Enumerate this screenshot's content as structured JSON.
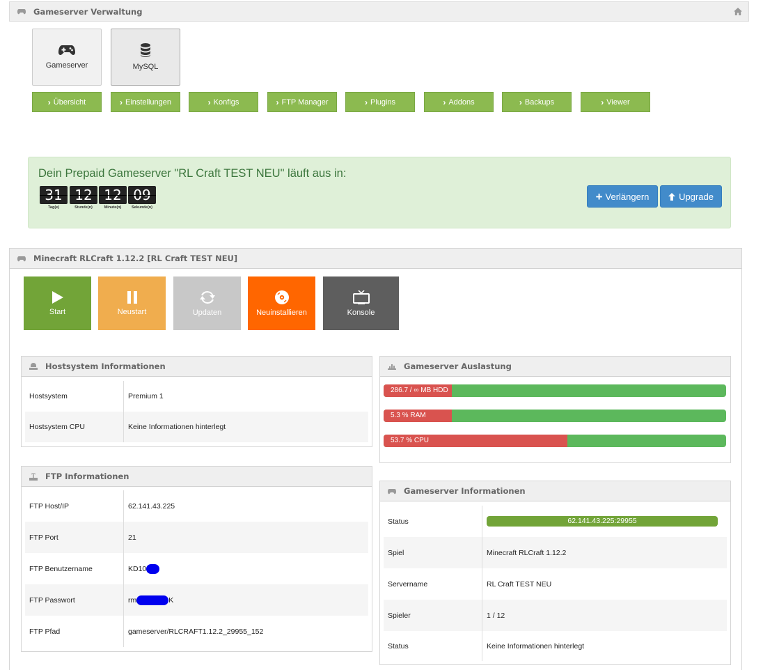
{
  "top": {
    "title": "Gameserver Verwaltung"
  },
  "tiles": [
    {
      "label": "Gameserver",
      "icon": "gamepad-icon"
    },
    {
      "label": "MySQL",
      "icon": "database-icon"
    }
  ],
  "nav": [
    "Übersicht",
    "Einstellungen",
    "Konfigs",
    "FTP Manager",
    "Plugins",
    "Addons",
    "Backups",
    "Viewer"
  ],
  "prepaid": {
    "text": "Dein Prepaid Gameserver \"RL Craft TEST NEU\" läuft aus in:",
    "countdown": [
      {
        "value": "31",
        "label": "Tag(e)"
      },
      {
        "value": "12",
        "label": "Stunde(n)"
      },
      {
        "value": "12",
        "label": "Minute(n)"
      },
      {
        "value": "09",
        "label": "Sekunde(n)"
      }
    ],
    "extend_label": "Verlängern",
    "upgrade_label": "Upgrade"
  },
  "server": {
    "title": "Minecraft RLCraft 1.12.2 [RL Craft TEST NEU]",
    "actions": [
      {
        "label": "Start",
        "color": "#72a438",
        "icon": "play-icon"
      },
      {
        "label": "Neustart",
        "color": "#f0ad4e",
        "icon": "pause-icon"
      },
      {
        "label": "Updaten",
        "color": "#c8c8c8",
        "icon": "refresh-icon"
      },
      {
        "label": "Neuinstallieren",
        "color": "#ff6600",
        "icon": "disc-icon"
      },
      {
        "label": "Konsole",
        "color": "#5e5e5e",
        "icon": "monitor-icon"
      }
    ]
  },
  "hostsystem": {
    "title": "Hostsystem Informationen",
    "rows": [
      {
        "key": "Hostsystem",
        "value": "Premium 1"
      },
      {
        "key": "Hostsystem CPU",
        "value": "Keine Informationen hinterlegt"
      }
    ]
  },
  "ftp": {
    "title": "FTP Informationen",
    "rows": [
      {
        "key": "FTP Host/IP",
        "value": "62.141.43.225"
      },
      {
        "key": "FTP Port",
        "value": "21"
      },
      {
        "key": "FTP Benutzername",
        "value": "KD10"
      },
      {
        "key": "FTP Passwort",
        "value_prefix": "rm",
        "value_suffix": "K"
      },
      {
        "key": "FTP Pfad",
        "value": "gameserver/RLCRAFT1.12.2_29955_152"
      }
    ]
  },
  "load": {
    "title": "Gameserver Auslastung",
    "bars": [
      {
        "label": "286.7 / ∞ MB HDD",
        "fraction": 0.2
      },
      {
        "label": "5.3 % RAM",
        "fraction": 0.2
      },
      {
        "label": "53.7 % CPU",
        "fraction": 0.537
      }
    ]
  },
  "gsinfo": {
    "title": "Gameserver Informationen",
    "rows": [
      {
        "key": "Status",
        "value": "62.141.43.225:29955"
      },
      {
        "key": "Spiel",
        "value": "Minecraft RLCraft 1.12.2"
      },
      {
        "key": "Servername",
        "value": "RL Craft TEST NEU"
      },
      {
        "key": "Spieler",
        "value": "1 / 12"
      },
      {
        "key": "Status",
        "value": "Keine Informationen hinterlegt"
      }
    ]
  },
  "colors": {
    "green": "#8cba50",
    "blue": "#428bca",
    "red": "#d9534f",
    "bar_green": "#5cb85c"
  }
}
